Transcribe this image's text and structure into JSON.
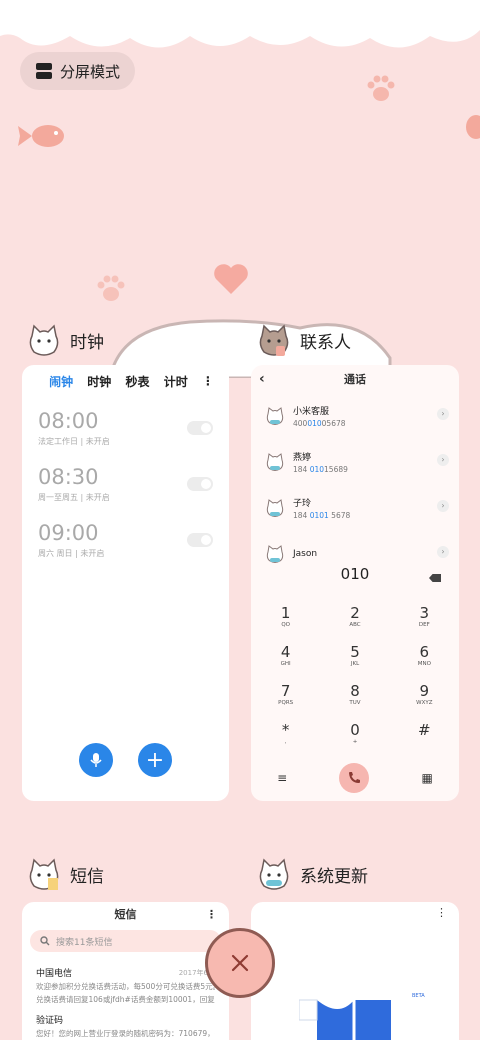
{
  "split_button": {
    "label": "分屏模式",
    "icon": "split-screen-icon"
  },
  "colors": {
    "background": "#fbe1e0",
    "accent": "#2a86e8",
    "card": "#ffffff",
    "pink_button": "#f7b9b0"
  },
  "clock": {
    "app_name": "时钟",
    "tabs": [
      "闹钟",
      "时钟",
      "秒表",
      "计时"
    ],
    "alarms": [
      {
        "time": "08:00",
        "desc": "法定工作日 | 未开启"
      },
      {
        "time": "08:30",
        "desc": "周一至周五 | 未开启"
      },
      {
        "time": "09:00",
        "desc": "周六 周日 | 未开启"
      }
    ],
    "add_symbol": "+"
  },
  "contacts": {
    "app_name": "联系人",
    "title": "通话",
    "entries": [
      {
        "name": "小米客服",
        "pre": "400",
        "hl": "010",
        "post": "05678"
      },
      {
        "name": "燕婷",
        "pre": "184 ",
        "hl": "010",
        "post": "15689"
      },
      {
        "name": "子玲",
        "pre": "184 ",
        "hl": "0101",
        "post": " 5678"
      },
      {
        "name": "Jason",
        "pre": "",
        "hl": "",
        "post": ""
      }
    ],
    "dial_input": "010",
    "keys": [
      {
        "d": "1",
        "l": "QO"
      },
      {
        "d": "2",
        "l": "ABC"
      },
      {
        "d": "3",
        "l": "DEF"
      },
      {
        "d": "4",
        "l": "GHI"
      },
      {
        "d": "5",
        "l": "JKL"
      },
      {
        "d": "6",
        "l": "MNO"
      },
      {
        "d": "7",
        "l": "PQRS"
      },
      {
        "d": "8",
        "l": "TUV"
      },
      {
        "d": "9",
        "l": "WXYZ"
      },
      {
        "d": "*",
        "l": ","
      },
      {
        "d": "0",
        "l": "+"
      },
      {
        "d": "#",
        "l": ""
      }
    ]
  },
  "sms": {
    "app_name": "短信",
    "title": "短信",
    "search_placeholder": "搜索11条短信",
    "messages": [
      {
        "sender": "中国电信",
        "date": "2017年6月",
        "line1": "欢迎参加积分兑换话费活动，每500分可兑换话费5元。",
        "line2": "兑换话费请回复106或jfdh#话费金额到10001，回复..."
      },
      {
        "sender": "验证码",
        "date": "",
        "line1": "您好！您的网上营业厅登录的随机密码为：710679，有",
        "line2": ""
      }
    ]
  },
  "update": {
    "app_name": "系统更新",
    "badge": "BETA"
  }
}
